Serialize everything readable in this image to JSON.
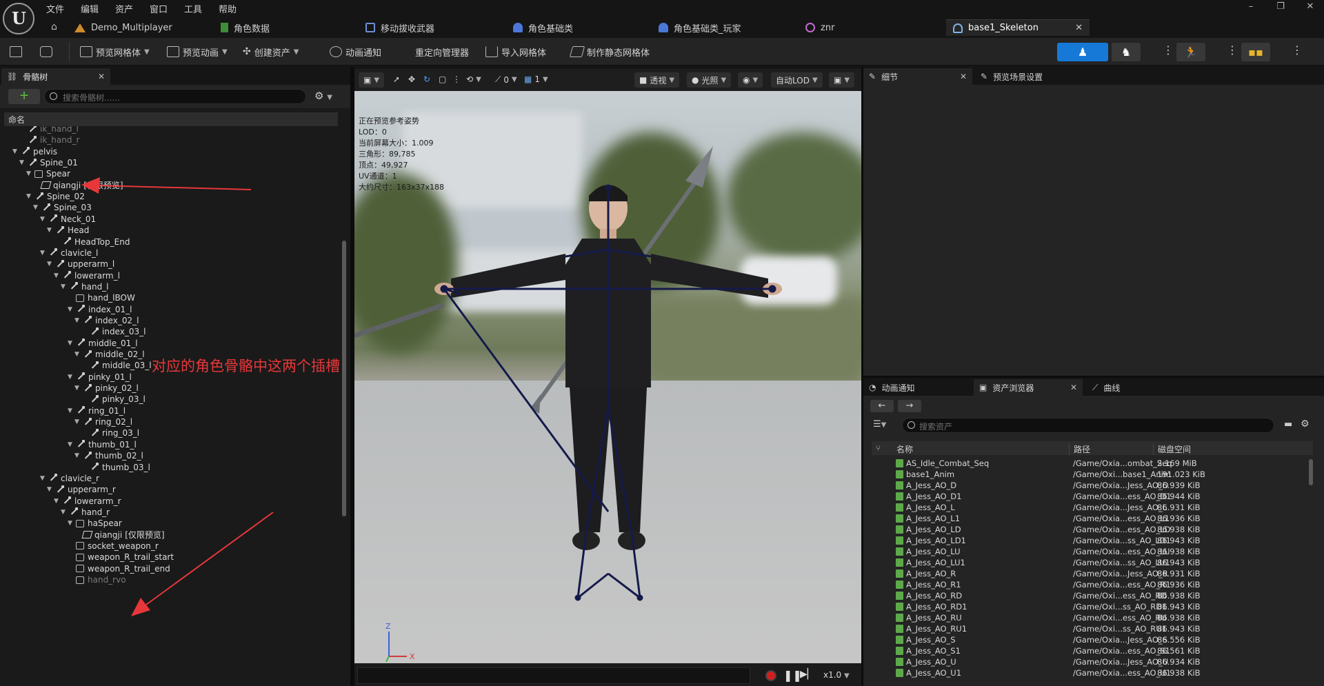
{
  "menu": [
    "文件",
    "编辑",
    "资产",
    "窗口",
    "工具",
    "帮助"
  ],
  "tabs": [
    {
      "label": "Demo_Multiplayer",
      "icon": "map-icon"
    },
    {
      "label": "角色数据",
      "icon": "data-icon"
    },
    {
      "label": "移动拔收武器",
      "icon": "blueprint-icon"
    },
    {
      "label": "角色基础类",
      "icon": "character-icon"
    },
    {
      "label": "角色基础类_玩家",
      "icon": "character-icon"
    },
    {
      "label": "znr",
      "icon": "physics-icon"
    },
    {
      "label": "base1_Skeleton",
      "icon": "skeleton-icon",
      "active": true
    }
  ],
  "toolbar": {
    "preview_mesh": "预览网格体",
    "preview_anim": "预览动画",
    "create_asset": "创建资产",
    "anim_notify": "动画通知",
    "retarget_manager": "重定向管理器",
    "import_mesh": "导入网格体",
    "make_static_mesh": "制作静态网格体"
  },
  "skeleton_panel": {
    "tab_label": "骨骼树",
    "search_placeholder": "搜索骨骼树......",
    "column_header": "命名",
    "tree": [
      {
        "label": "ik_hand_l",
        "depth": 2,
        "type": "bone",
        "dim": true
      },
      {
        "label": "ik_hand_r",
        "depth": 2,
        "type": "bone",
        "dim": true
      },
      {
        "label": "pelvis",
        "depth": 1,
        "type": "bone",
        "open": true
      },
      {
        "label": "Spine_01",
        "depth": 2,
        "type": "bone",
        "open": true
      },
      {
        "label": "Spear",
        "depth": 3,
        "type": "socket",
        "open": true
      },
      {
        "label": "qiangji",
        "suffix": "[仅限预览]",
        "depth": 4,
        "type": "mesh"
      },
      {
        "label": "Spine_02",
        "depth": 3,
        "type": "bone",
        "open": true
      },
      {
        "label": "Spine_03",
        "depth": 4,
        "type": "bone",
        "open": true
      },
      {
        "label": "Neck_01",
        "depth": 5,
        "type": "bone",
        "open": true
      },
      {
        "label": "Head",
        "depth": 6,
        "type": "bone",
        "open": true
      },
      {
        "label": "HeadTop_End",
        "depth": 7,
        "type": "bone"
      },
      {
        "label": "clavicle_l",
        "depth": 5,
        "type": "bone",
        "open": true
      },
      {
        "label": "upperarm_l",
        "depth": 6,
        "type": "bone",
        "open": true
      },
      {
        "label": "lowerarm_l",
        "depth": 7,
        "type": "bone",
        "open": true
      },
      {
        "label": "hand_l",
        "depth": 8,
        "type": "bone",
        "open": true
      },
      {
        "label": "hand_lBOW",
        "depth": 9,
        "type": "socket"
      },
      {
        "label": "index_01_l",
        "depth": 9,
        "type": "bone",
        "open": true
      },
      {
        "label": "index_02_l",
        "depth": 10,
        "type": "bone",
        "open": true
      },
      {
        "label": "index_03_l",
        "depth": 11,
        "type": "bone"
      },
      {
        "label": "middle_01_l",
        "depth": 9,
        "type": "bone",
        "open": true
      },
      {
        "label": "middle_02_l",
        "depth": 10,
        "type": "bone",
        "open": true
      },
      {
        "label": "middle_03_l",
        "depth": 11,
        "type": "bone"
      },
      {
        "label": "pinky_01_l",
        "depth": 9,
        "type": "bone",
        "open": true
      },
      {
        "label": "pinky_02_l",
        "depth": 10,
        "type": "bone",
        "open": true
      },
      {
        "label": "pinky_03_l",
        "depth": 11,
        "type": "bone"
      },
      {
        "label": "ring_01_l",
        "depth": 9,
        "type": "bone",
        "open": true
      },
      {
        "label": "ring_02_l",
        "depth": 10,
        "type": "bone",
        "open": true
      },
      {
        "label": "ring_03_l",
        "depth": 11,
        "type": "bone"
      },
      {
        "label": "thumb_01_l",
        "depth": 9,
        "type": "bone",
        "open": true
      },
      {
        "label": "thumb_02_l",
        "depth": 10,
        "type": "bone",
        "open": true
      },
      {
        "label": "thumb_03_l",
        "depth": 11,
        "type": "bone"
      },
      {
        "label": "clavicle_r",
        "depth": 5,
        "type": "bone",
        "open": true
      },
      {
        "label": "upperarm_r",
        "depth": 6,
        "type": "bone",
        "open": true
      },
      {
        "label": "lowerarm_r",
        "depth": 7,
        "type": "bone",
        "open": true
      },
      {
        "label": "hand_r",
        "depth": 8,
        "type": "bone",
        "open": true
      },
      {
        "label": "haSpear",
        "depth": 9,
        "type": "socket",
        "open": true
      },
      {
        "label": "qiangji",
        "suffix": "[仅限预览]",
        "depth": 10,
        "type": "mesh"
      },
      {
        "label": "socket_weapon_r",
        "depth": 9,
        "type": "socket"
      },
      {
        "label": "weapon_R_trail_start",
        "depth": 9,
        "type": "socket"
      },
      {
        "label": "weapon_R_trail_end",
        "depth": 9,
        "type": "socket"
      },
      {
        "label": "hand_rvo",
        "depth": 9,
        "type": "socket",
        "dim": true
      }
    ],
    "annotation": "对应的角色骨骼中这两个插槽",
    "annotation_color": "#e8373a"
  },
  "viewport": {
    "toolbar": {
      "perspective": "透视",
      "lighting": "光照",
      "lod": "自动LOD",
      "snap_angle": "0",
      "camera_speed": "1"
    },
    "info": [
      "正在预览参考姿势",
      "LOD：0",
      "当前屏幕大小：1.009",
      "三角形：89,785",
      "顶点：49,927",
      "UV通道：1",
      "大约尺寸：163x37x188"
    ],
    "axis": {
      "z": "Z",
      "x": "X"
    },
    "playback_speed": "x1.0"
  },
  "details_panel": {
    "tab_details": "细节",
    "tab_preview_scene": "预览场景设置"
  },
  "asset_panel": {
    "tab_anim_notify": "动画通知",
    "tab_asset_browser": "资产浏览器",
    "tab_curves": "曲线",
    "search_placeholder": "搜索资产",
    "columns": {
      "name": "名称",
      "path": "路径",
      "disk": "磁盘空间"
    },
    "rows": [
      {
        "name": "AS_Idle_Combat_Seq",
        "path": "/Game/Oxia...ombat_Seq",
        "size": "2.169 MiB"
      },
      {
        "name": "base1_Anim",
        "path": "/Game/Oxi...base1_Anim",
        "size": "191.023 KiB"
      },
      {
        "name": "A_Jess_AO_D",
        "path": "/Game/Oxia...Jess_AO_D",
        "size": "86.939 KiB"
      },
      {
        "name": "A_Jess_AO_D1",
        "path": "/Game/Oxia...ess_AO_D1",
        "size": "86.944 KiB"
      },
      {
        "name": "A_Jess_AO_L",
        "path": "/Game/Oxia...Jess_AO_L",
        "size": "86.931 KiB"
      },
      {
        "name": "A_Jess_AO_L1",
        "path": "/Game/Oxia...ess_AO_L1",
        "size": "86.936 KiB"
      },
      {
        "name": "A_Jess_AO_LD",
        "path": "/Game/Oxia...ess_AO_LD",
        "size": "86.938 KiB"
      },
      {
        "name": "A_Jess_AO_LD1",
        "path": "/Game/Oxia...ss_AO_LD1",
        "size": "86.943 KiB"
      },
      {
        "name": "A_Jess_AO_LU",
        "path": "/Game/Oxia...ess_AO_LU",
        "size": "86.938 KiB"
      },
      {
        "name": "A_Jess_AO_LU1",
        "path": "/Game/Oxia...ss_AO_LU1",
        "size": "86.943 KiB"
      },
      {
        "name": "A_Jess_AO_R",
        "path": "/Game/Oxia...Jess_AO_R",
        "size": "86.931 KiB"
      },
      {
        "name": "A_Jess_AO_R1",
        "path": "/Game/Oxia...ess_AO_R1",
        "size": "86.936 KiB"
      },
      {
        "name": "A_Jess_AO_RD",
        "path": "/Game/Oxi...ess_AO_RD",
        "size": "86.938 KiB"
      },
      {
        "name": "A_Jess_AO_RD1",
        "path": "/Game/Oxi...ss_AO_RD1",
        "size": "86.943 KiB"
      },
      {
        "name": "A_Jess_AO_RU",
        "path": "/Game/Oxi...ess_AO_RU",
        "size": "86.938 KiB"
      },
      {
        "name": "A_Jess_AO_RU1",
        "path": "/Game/Oxi...ss_AO_RU1",
        "size": "86.943 KiB"
      },
      {
        "name": "A_Jess_AO_S",
        "path": "/Game/Oxia...Jess_AO_S",
        "size": "86.556 KiB"
      },
      {
        "name": "A_Jess_AO_S1",
        "path": "/Game/Oxia...ess_AO_S1",
        "size": "86.561 KiB"
      },
      {
        "name": "A_Jess_AO_U",
        "path": "/Game/Oxia...Jess_AO_U",
        "size": "86.934 KiB"
      },
      {
        "name": "A_Jess_AO_U1",
        "path": "/Game/Oxia...ess_AO_U1",
        "size": "86.938 KiB"
      }
    ]
  }
}
